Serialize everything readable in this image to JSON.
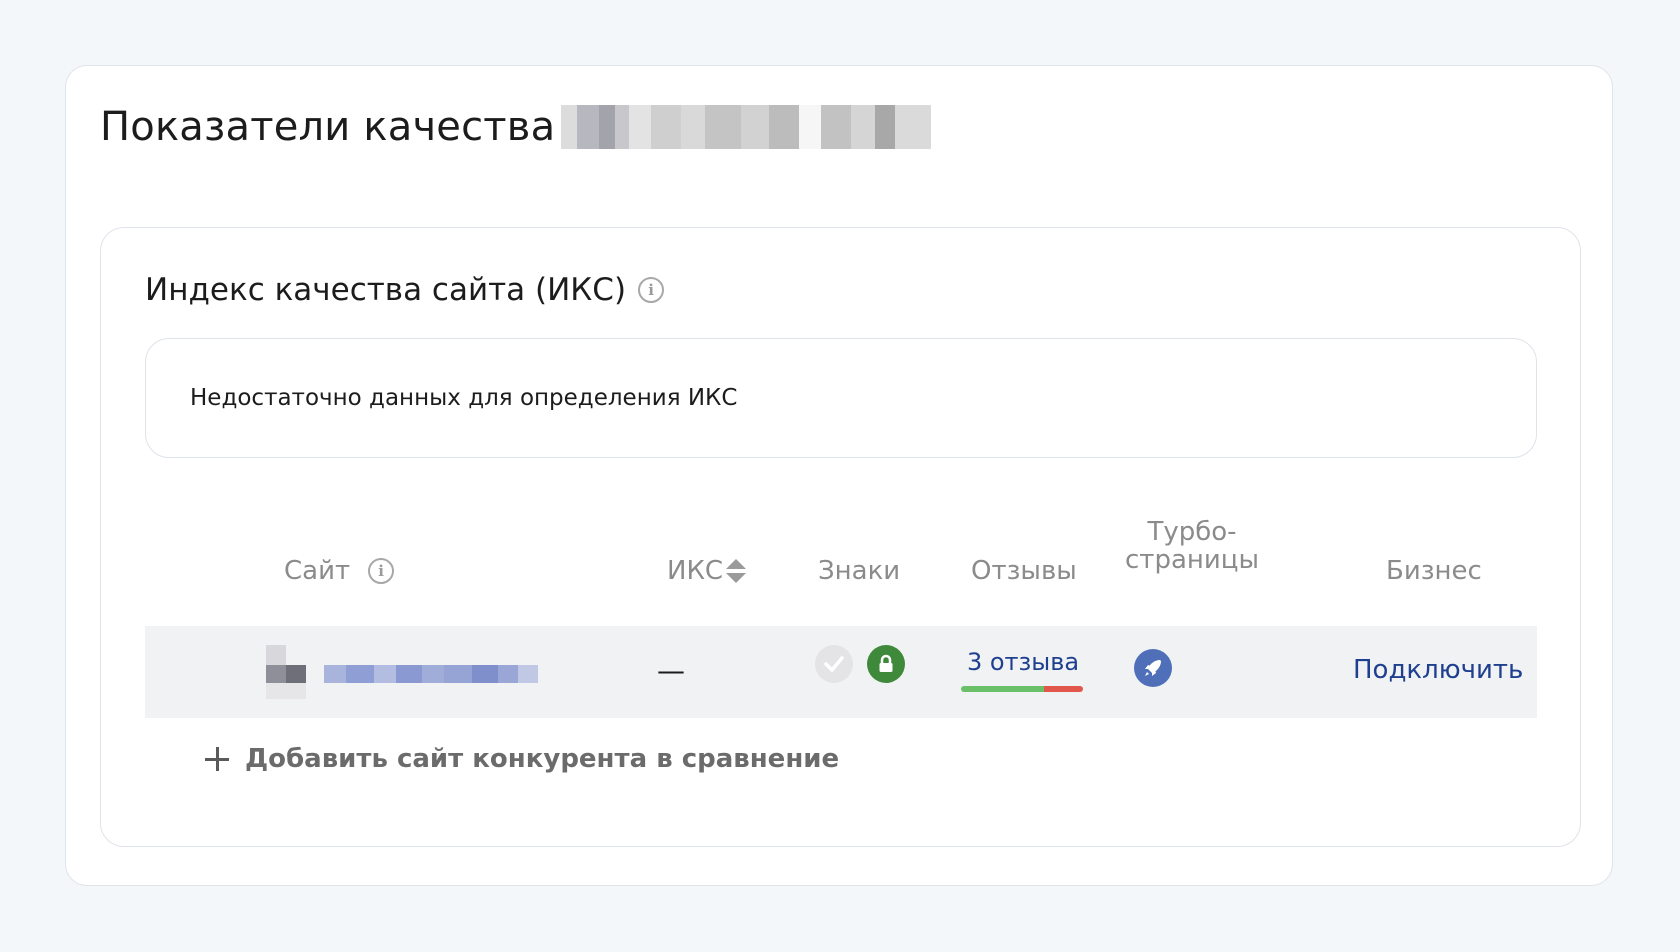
{
  "page": {
    "title": "Показатели качества"
  },
  "iks_section": {
    "title": "Индекс качества сайта (ИКС)",
    "info_icon": "info-icon",
    "notice": "Недостаточно данных для определения ИКС"
  },
  "table": {
    "columns": {
      "site": "Сайт",
      "iks": "ИКС",
      "signs": "Знаки",
      "reviews": "Отзывы",
      "turbo_line1": "Турбо-",
      "turbo_line2": "страницы",
      "business": "Бизнес"
    },
    "row": {
      "iks_value": "—",
      "signs": [
        "check-badge-icon",
        "lock-badge-icon"
      ],
      "reviews_link": "3 отзыва",
      "reviews_positive_fraction": 0.68,
      "turbo_icon": "rocket-icon",
      "business_link": "Подключить"
    }
  },
  "add_competitor": {
    "label": "Добавить сайт конкурента в сравнение"
  },
  "colors": {
    "background": "#f4f7fa",
    "link": "#1f3f8f",
    "positive": "#6abf69",
    "negative": "#e2574c",
    "lock_badge": "#3f8a3a",
    "rocket_badge": "#4f6fb8"
  }
}
